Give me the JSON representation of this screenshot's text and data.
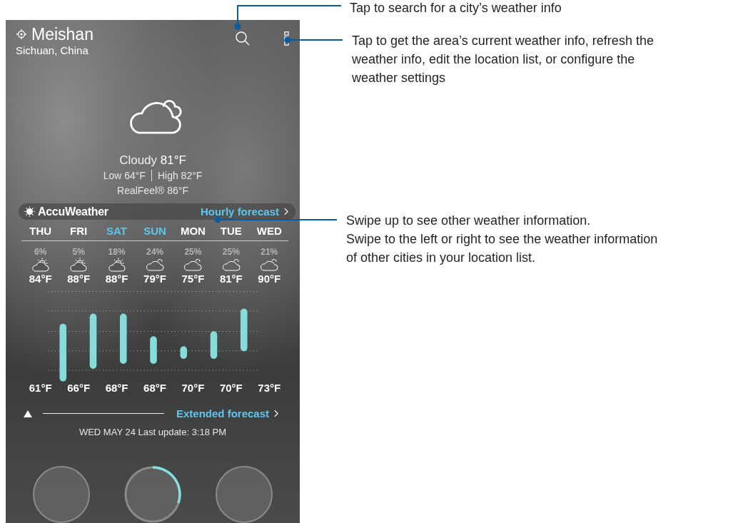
{
  "location": {
    "name": "Meishan",
    "region": "Sichuan, China"
  },
  "current": {
    "condition": "Cloudy",
    "temp": "81°F",
    "low": "Low 64°F",
    "high": "High 82°F",
    "realfeel": "RealFeel® 86°F"
  },
  "provider": "AccuWeather",
  "hourly_link": "Hourly forecast",
  "days": [
    {
      "day": "THU",
      "weekend": false,
      "precip": "6%",
      "kind": "partly-sunny",
      "high": "84°F",
      "low": "61°F"
    },
    {
      "day": "FRI",
      "weekend": false,
      "precip": "5%",
      "kind": "partly-sunny",
      "high": "88°F",
      "low": "66°F"
    },
    {
      "day": "SAT",
      "weekend": true,
      "precip": "18%",
      "kind": "partly-sunny",
      "high": "88°F",
      "low": "68°F"
    },
    {
      "day": "SUN",
      "weekend": true,
      "precip": "24%",
      "kind": "cloudy",
      "high": "79°F",
      "low": "68°F"
    },
    {
      "day": "MON",
      "weekend": false,
      "precip": "25%",
      "kind": "cloudy",
      "high": "75°F",
      "low": "70°F"
    },
    {
      "day": "TUE",
      "weekend": false,
      "precip": "25%",
      "kind": "cloudy",
      "high": "81°F",
      "low": "70°F"
    },
    {
      "day": "WED",
      "weekend": false,
      "precip": "21%",
      "kind": "cloudy",
      "high": "90°F",
      "low": "73°F"
    }
  ],
  "extended_link": "Extended forecast",
  "last_update": "WED MAY 24 Last update: 3:18 PM",
  "annotations": [
    {
      "lines": [
        "Tap to search for a city’s weather info"
      ]
    },
    {
      "lines": [
        "Tap to get the area’s current weather info, refresh the",
        "weather info, edit the location list, or configure the",
        "weather settings"
      ]
    },
    {
      "lines": [
        "Swipe up to see other weather information.",
        "Swipe to the left or right to see the weather information",
        "of other cities in your location list."
      ]
    }
  ]
}
